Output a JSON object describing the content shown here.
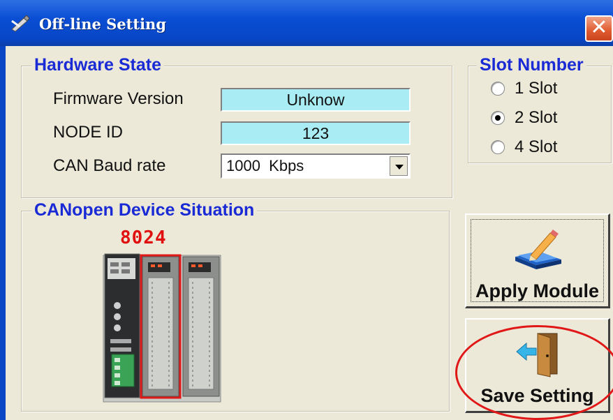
{
  "window": {
    "title": "Off-line Setting",
    "title_icon": "wrench-pencil-icon",
    "close_symbol": "✕"
  },
  "hardware_state": {
    "legend": "Hardware State",
    "firmware_label": "Firmware Version",
    "firmware_value": "Unknow",
    "node_id_label": "NODE ID",
    "node_id_value": "123",
    "baud_label": "CAN Baud rate",
    "baud_value": "1000  Kbps"
  },
  "slot_number": {
    "legend": "Slot Number",
    "options": [
      {
        "label": "1  Slot",
        "checked": false
      },
      {
        "label": "2  Slot",
        "checked": true
      },
      {
        "label": "4  Slot",
        "checked": false
      }
    ]
  },
  "device_situation": {
    "legend": "CANopen Device Situation",
    "module_label": "8024",
    "modules": [
      {
        "model": "8024",
        "selected": true
      },
      {
        "model": "",
        "selected": false
      }
    ]
  },
  "buttons": {
    "apply_label": "Apply Module",
    "apply_icon": "pencil-notepad-icon",
    "save_label": "Save Setting",
    "save_icon": "door-exit-icon"
  },
  "colors": {
    "legend_text": "#1a2bd6",
    "field_bg": "#a9ecf4",
    "highlight": "#e01818",
    "titlebar": "#0a4ed4"
  }
}
